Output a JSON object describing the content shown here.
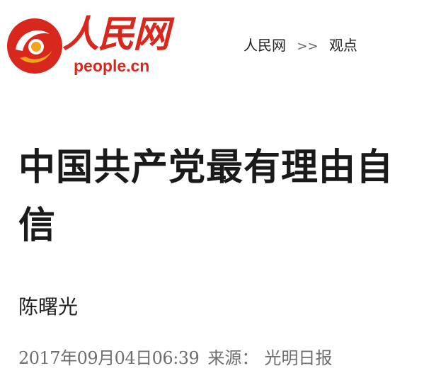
{
  "header": {
    "logo": {
      "icon": "people-daily-logo-icon",
      "name_cn": "人民网",
      "domain": "people.cn",
      "brand_color": "#d8271c"
    },
    "breadcrumb": {
      "site": "人民网",
      "separator": ">>",
      "section": "观点"
    }
  },
  "article": {
    "title": "中国共产党最有理由自信",
    "author": "陈曙光",
    "datetime": "2017年09月04日06:39",
    "source_label": "来源：",
    "source_name": "光明日报"
  }
}
